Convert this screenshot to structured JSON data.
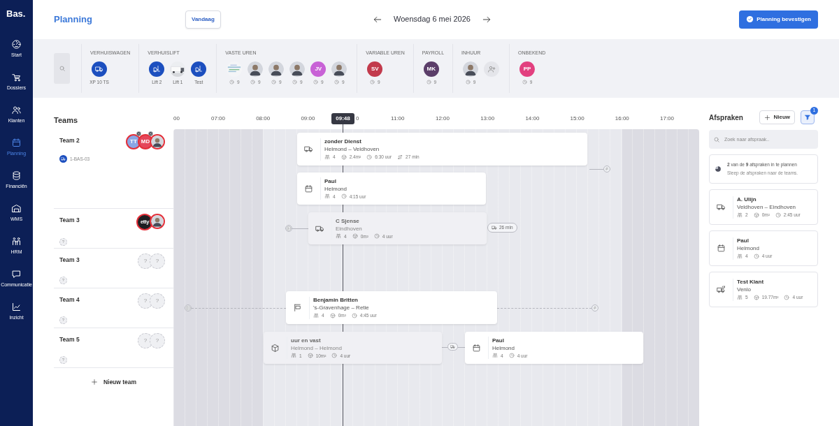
{
  "sidebar": {
    "logo": "Bas.",
    "items": [
      {
        "label": "Start",
        "selected": false
      },
      {
        "label": "Dossiers",
        "selected": false
      },
      {
        "label": "Klanten",
        "selected": false
      },
      {
        "label": "Planning",
        "selected": true
      },
      {
        "label": "Financiën",
        "selected": false
      },
      {
        "label": "WMS",
        "selected": false
      },
      {
        "label": "HRM",
        "selected": false
      },
      {
        "label": "Communicatie",
        "selected": false
      },
      {
        "label": "Inzicht",
        "selected": false
      }
    ]
  },
  "header": {
    "title": "Planning",
    "today_button": "Vandaag",
    "date": "Woensdag 6 mei 2026",
    "confirm_button": "Planning bevestigen"
  },
  "resources": {
    "groups": [
      {
        "title": "VERHUISWAGEN",
        "items": [
          {
            "kind": "vehicle",
            "label": "XP 10 TS"
          }
        ]
      },
      {
        "title": "VERHUISLIFT",
        "items": [
          {
            "kind": "lift",
            "label": "Lift 2"
          },
          {
            "label": "Lift 1"
          },
          {
            "kind": "lift",
            "label": "Test"
          }
        ]
      },
      {
        "title": "VASTE UREN",
        "items": [
          {
            "hours": "9"
          },
          {
            "kind": "person",
            "hours": "9"
          },
          {
            "kind": "person",
            "hours": "9"
          },
          {
            "kind": "person",
            "hours": "9"
          },
          {
            "kind": "initials",
            "initials": "JV",
            "color": "#c862d6",
            "hours": "9"
          },
          {
            "kind": "person",
            "hours": "9"
          }
        ]
      },
      {
        "title": "VARIABLE UREN",
        "items": [
          {
            "kind": "initials",
            "initials": "SV",
            "color": "#c23a4c",
            "hours": "9"
          }
        ]
      },
      {
        "title": "PAYROLL",
        "items": [
          {
            "kind": "initials",
            "initials": "MK",
            "color": "#5b3e69",
            "hours": "9"
          }
        ]
      },
      {
        "title": "INHUUR",
        "items": [
          {
            "kind": "person",
            "hours": "9"
          },
          {
            "kind": "add"
          }
        ]
      },
      {
        "title": "ONBEKEND",
        "items": [
          {
            "kind": "initials",
            "initials": "PP",
            "color": "#e2407f",
            "hours": "9"
          }
        ]
      }
    ]
  },
  "teams": {
    "title": "Teams",
    "rows": [
      {
        "name": "Team 2",
        "members": [
          {
            "kind": "initials",
            "initials": "TT",
            "color": "#8aa6e4",
            "alert": true,
            "removable": true
          },
          {
            "kind": "initials",
            "initials": "MD",
            "color": "#e5475b",
            "alert": true,
            "removable": true
          },
          {
            "kind": "person",
            "alert": true,
            "removable": false
          }
        ],
        "vehicle": {
          "kind": "vehicle",
          "label": "1-BAS-03"
        }
      },
      {
        "name": "Team 3",
        "members": [
          {
            "kind": "initials",
            "initials": "etty",
            "color": "#1f1f22",
            "alert": true,
            "removable": false
          },
          {
            "kind": "person",
            "alert": true,
            "removable": false
          }
        ],
        "vehicle": {
          "kind": "open",
          "label": "?"
        }
      },
      {
        "name": "Team 3",
        "members": [
          {
            "kind": "open",
            "initials": "?"
          },
          {
            "kind": "open",
            "initials": "?"
          }
        ],
        "vehicle": {
          "kind": "open",
          "label": "?"
        }
      },
      {
        "name": "Team 4",
        "members": [
          {
            "kind": "open",
            "initials": "?"
          },
          {
            "kind": "open",
            "initials": "?"
          }
        ],
        "vehicle": {
          "kind": "open",
          "label": "?"
        }
      },
      {
        "name": "Team 5",
        "members": [
          {
            "kind": "open",
            "initials": "?"
          },
          {
            "kind": "open",
            "initials": "?"
          }
        ],
        "vehicle": {
          "kind": "open",
          "label": "?"
        }
      }
    ],
    "add_button": "Nieuw team"
  },
  "timeline": {
    "hours": [
      "00",
      "07:00",
      "08:00",
      "09:00",
      "0",
      "11:00",
      "12:00",
      "13:00",
      "14:00",
      "15:00",
      "16:00",
      "17:00"
    ],
    "now": "09:48",
    "appointments": [
      {
        "kind": "move",
        "title": "zonder Dienst",
        "subtitle": "Helmond – Veldhoven",
        "dimmed": false,
        "meta": [
          {
            "kind": "people",
            "text": "4"
          },
          {
            "kind": "volume",
            "text": "2.4m²"
          },
          {
            "kind": "duration",
            "text": "6:30 uur"
          },
          {
            "kind": "travel",
            "text": "27 min"
          }
        ]
      },
      {
        "kind": "calendar",
        "title": "Paul",
        "subtitle": "Helmond",
        "dimmed": false,
        "meta": [
          {
            "kind": "people",
            "text": "4"
          },
          {
            "kind": "duration",
            "text": "4:15 uur"
          }
        ]
      },
      {
        "kind": "move",
        "title": "C Sjense",
        "subtitle": "Eindhoven",
        "dimmed": true,
        "travel_after": "26 min",
        "meta": [
          {
            "kind": "people",
            "text": "4"
          },
          {
            "kind": "volume",
            "text": "0m²"
          },
          {
            "kind": "duration",
            "text": "4 uur"
          }
        ]
      },
      {
        "kind": "flag",
        "title": "Benjamin Britten",
        "subtitle": "'s-Gravenhage – Retie",
        "dimmed": false,
        "meta": [
          {
            "kind": "people",
            "text": "4"
          },
          {
            "kind": "volume",
            "text": "0m²"
          },
          {
            "kind": "duration",
            "text": "4:45 uur"
          }
        ]
      },
      {
        "kind": "box",
        "title": "uur en vast",
        "subtitle": "Helmond – Helmond",
        "dimmed": true,
        "meta": [
          {
            "kind": "people",
            "text": "1"
          },
          {
            "kind": "volume",
            "text": "10m²"
          },
          {
            "kind": "duration",
            "text": "4 uur"
          }
        ]
      },
      {
        "kind": "calendar",
        "title": "Paul",
        "subtitle": "Helmond",
        "dimmed": false,
        "meta": [
          {
            "kind": "people",
            "text": "4"
          },
          {
            "kind": "duration",
            "text": "4 uur"
          }
        ]
      }
    ]
  },
  "panel": {
    "title": "Afspraken",
    "new_button": "Nieuw",
    "filter_count": "1",
    "search_placeholder": "Zoek naar afspraak..",
    "summary": "**2** van de **9** afspraken in te plannen",
    "hint": "Sleep de afspraken naar de teams.",
    "items": [
      {
        "kind": "move",
        "title": "A. Ulijn",
        "subtitle": "Veldhoven – Eindhoven",
        "meta": [
          {
            "kind": "people",
            "text": "2"
          },
          {
            "kind": "volume",
            "text": "0m²"
          },
          {
            "kind": "duration",
            "text": "2:45 uur"
          }
        ]
      },
      {
        "kind": "calendar",
        "title": "Paul",
        "subtitle": "Helmond",
        "meta": [
          {
            "kind": "people",
            "text": "4"
          },
          {
            "kind": "duration",
            "text": "4 uur"
          }
        ]
      },
      {
        "kind": "move-repeat",
        "title": "Test Klant",
        "subtitle": "Venlo",
        "meta": [
          {
            "kind": "people",
            "text": "5"
          },
          {
            "kind": "volume",
            "text": "19.77m²"
          },
          {
            "kind": "duration",
            "text": "4 uur"
          }
        ]
      }
    ]
  }
}
